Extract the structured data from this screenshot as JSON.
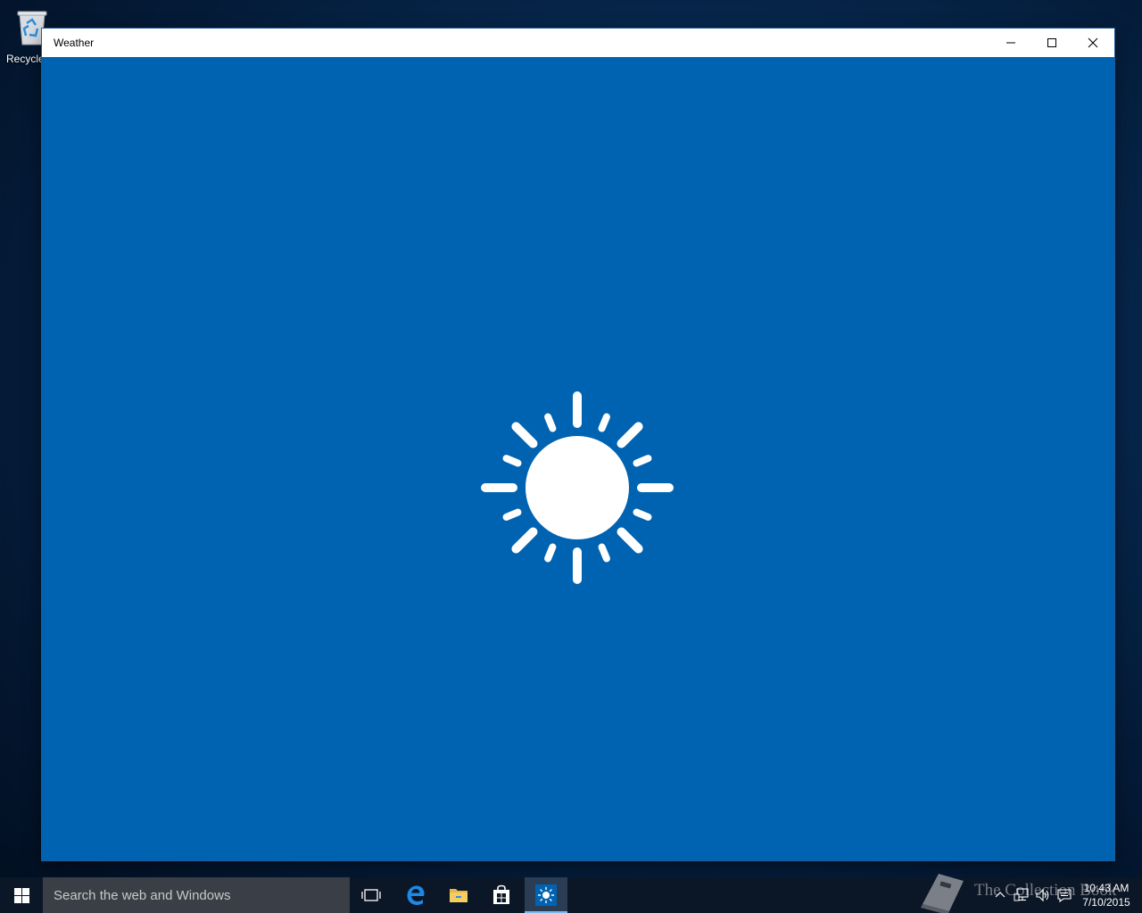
{
  "desktop": {
    "recycle_bin_label": "Recycle",
    "recycle_bin_icon": "recycle-bin-icon"
  },
  "window": {
    "title": "Weather",
    "content_color": "#0063b1",
    "splash_icon": "sun-icon",
    "controls": {
      "minimize_icon": "minimize-icon",
      "maximize_icon": "maximize-icon",
      "close_icon": "close-icon"
    }
  },
  "taskbar": {
    "start_icon": "windows-logo-icon",
    "search_placeholder": "Search the web and Windows",
    "apps": [
      {
        "name": "Task View",
        "icon": "task-view-icon"
      },
      {
        "name": "Microsoft Edge",
        "icon": "edge-icon"
      },
      {
        "name": "File Explorer",
        "icon": "folder-icon"
      },
      {
        "name": "Store",
        "icon": "store-icon"
      },
      {
        "name": "Weather",
        "icon": "weather-icon",
        "active": true
      }
    ],
    "tray": {
      "icons": [
        "chevron-up-icon",
        "network-icon",
        "volume-icon",
        "message-icon"
      ],
      "time": "10:43 AM",
      "date": "7/10/2015"
    },
    "watermark_text": "The Collection Book"
  },
  "colors": {
    "accent": "#0063b1",
    "taskbar": "#0b1626",
    "search_box": "#3a3f47"
  }
}
